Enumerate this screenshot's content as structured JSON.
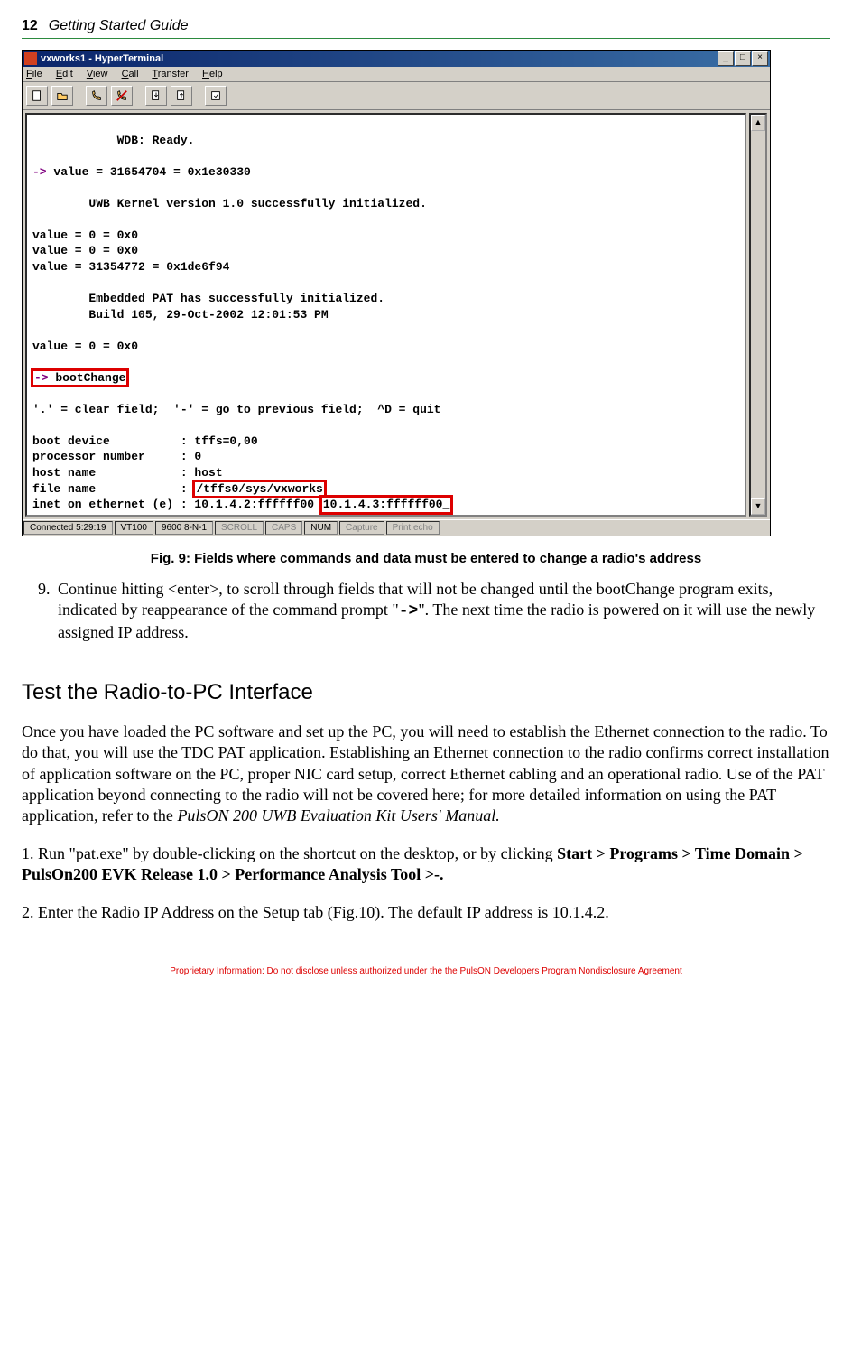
{
  "page": {
    "number": "12",
    "title": "Getting Started Guide"
  },
  "win": {
    "title": "vxworks1 - HyperTerminal",
    "menu": {
      "file": "File",
      "edit": "Edit",
      "view": "View",
      "call": "Call",
      "transfer": "Transfer",
      "help": "Help"
    }
  },
  "term": {
    "l1": "            WDB: Ready.",
    "l2p": "-> ",
    "l2": "value = 31654704 = 0x1e30330",
    "l3": "        UWB Kernel version 1.0 successfully initialized.",
    "l4": "value = 0 = 0x0",
    "l5": "value = 0 = 0x0",
    "l6": "value = 31354772 = 0x1de6f94",
    "l7": "        Embedded PAT has successfully initialized.",
    "l8": "        Build 105, 29-Oct-2002 12:01:53 PM",
    "l9": "value = 0 = 0x0",
    "l10p": "-> ",
    "l10": "bootChange",
    "l11": "'.' = clear field;  '-' = go to previous field;  ^D = quit",
    "l12": "boot device          : tffs=0,00",
    "l13": "processor number     : 0",
    "l14": "host name            : host",
    "l15a": "file name            : ",
    "l15b": "/tffs0/sys/vxworks",
    "l16a": "inet on ethernet (e) : 10.1.4.2:ffffff00 ",
    "l16b": "10.1.4.3:ffffff00_"
  },
  "status": {
    "conn": "Connected 5:29:19",
    "emul": "VT100",
    "baud": "9600 8-N-1",
    "scroll": "SCROLL",
    "caps": "CAPS",
    "num": "NUM",
    "capture": "Capture",
    "echo": "Print echo"
  },
  "fig": {
    "caption": "Fig. 9:  Fields where commands and data must be entered to change a radio's address"
  },
  "step9": {
    "a": "Continue hitting <enter>, to scroll through fields that will not be changed until the bootChange program exits, indicated by reappearance of the command prompt \"",
    "prompt": "->",
    "b": "\". The next time the radio is powered on it will use the newly assigned IP address."
  },
  "sec": {
    "heading": "Test the Radio-to-PC Interface"
  },
  "para1": {
    "a": "Once you have loaded the PC software and set up the PC, you will need to establish the Ethernet connection to the radio.  To do that, you will use the TDC PAT application. Establishing an Ethernet connection to the radio confirms correct installation of application software on the PC, proper NIC card setup, correct Ethernet cabling and an operational radio. Use of the PAT application beyond connecting to the radio will not be covered here; for more detailed information on using the PAT application, refer to the ",
    "i": "PulsON 200 UWB Evaluation Kit Users' Manual.",
    "b": ""
  },
  "step1": {
    "a": "1. Run \"pat.exe\" by double-clicking on the shortcut on the desktop, or by clicking ",
    "bold": "Start > Programs > Time Domain > PulsOn200 EVK Release 1.0 > Performance Analysis Tool >-.",
    "b": ""
  },
  "step2": {
    "text": "2. Enter the Radio IP Address on the Setup tab (Fig.10).  The default IP address is 10.1.4.2."
  },
  "footer": {
    "text": "Proprietary Information:  Do not disclose unless authorized under the the PulsON Developers Program Nondisclosure Agreement"
  }
}
